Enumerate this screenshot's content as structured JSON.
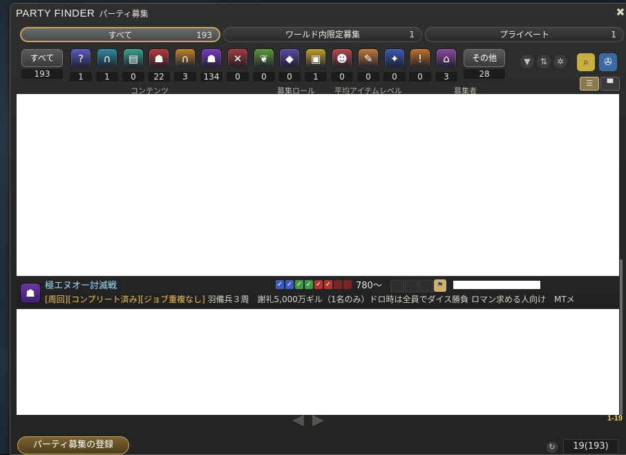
{
  "window": {
    "title": "PARTY FINDER",
    "subtitle": "パーティ募集",
    "close_glyph": "✖"
  },
  "tabs": [
    {
      "label": "すべて",
      "count": "193"
    },
    {
      "label": "ワールド内限定募集",
      "count": "1"
    },
    {
      "label": "プライベート",
      "count": "1"
    }
  ],
  "categories": {
    "all": {
      "label": "すべて",
      "count": "193"
    },
    "items": [
      {
        "icon": "question-icon",
        "glyph": "?",
        "color": "#5a5ac0",
        "count": "1"
      },
      {
        "icon": "arch-icon",
        "glyph": "∩",
        "color": "#2f8aa0",
        "count": "1"
      },
      {
        "icon": "scroll-icon",
        "glyph": "▤",
        "color": "#3aa08a",
        "count": "0"
      },
      {
        "icon": "beast-icon",
        "glyph": "☗",
        "color": "#b83a3a",
        "count": "22"
      },
      {
        "icon": "gate-icon",
        "glyph": "∩",
        "color": "#c0802a",
        "count": "3"
      },
      {
        "icon": "trial-icon",
        "glyph": "☗",
        "color": "#7a3ac0",
        "count": "134"
      },
      {
        "icon": "pvp-icon",
        "glyph": "✕",
        "color": "#a03a3a",
        "count": "0"
      },
      {
        "icon": "leaf-icon",
        "glyph": "❦",
        "color": "#5a9a3a",
        "count": "0"
      },
      {
        "icon": "gem-icon",
        "glyph": "◆",
        "color": "#5a4aa0",
        "count": "0"
      },
      {
        "icon": "treasure-icon",
        "glyph": "▣",
        "color": "#c0a02a",
        "count": "1"
      },
      {
        "icon": "skull-icon",
        "glyph": "☻",
        "color": "#b04a4a",
        "count": "0"
      },
      {
        "icon": "quill-icon",
        "glyph": "✎",
        "color": "#c07a3a",
        "count": "0"
      },
      {
        "icon": "star-icon",
        "glyph": "✦",
        "color": "#3a5ab0",
        "count": "0"
      },
      {
        "icon": "alert-icon",
        "glyph": "!",
        "color": "#c0702a",
        "count": "0"
      },
      {
        "icon": "people-icon",
        "glyph": "⌂",
        "color": "#8a4aa0",
        "count": "3"
      }
    ],
    "other": {
      "label": "その他",
      "count": "28"
    }
  },
  "tools": {
    "filter_glyph": "▼",
    "sort_glyph": "⇅",
    "settings_glyph": "✲",
    "search_glyph": "⌕",
    "detail_glyph": "✇"
  },
  "column_headers": {
    "content": "コンテンツ",
    "role": "募集ロール",
    "ilvl": "平均アイテムレベル",
    "recruiter": "募集者"
  },
  "view_toggle": {
    "compact": "☰",
    "detail": "▀"
  },
  "listing": {
    "duty_icon_glyph": "☗",
    "duty_name": "極エヌオー討滅戦",
    "tags": "[周回][コンプリート済み][ジョブ重複なし]",
    "description": " 羽備兵３周　謝礼5,000万ギル（1名のみ）ドロ時は全員でダイス勝負 ロマン求める人向け　MTメ",
    "slots": [
      {
        "role": "tank",
        "glyph": "✓"
      },
      {
        "role": "tank",
        "glyph": "✓"
      },
      {
        "role": "heal",
        "glyph": "✓"
      },
      {
        "role": "heal",
        "glyph": "✓"
      },
      {
        "role": "dps",
        "glyph": "✓"
      },
      {
        "role": "dps",
        "glyph": "✓"
      },
      {
        "role": "dps-empty",
        "glyph": ""
      },
      {
        "role": "dps-empty",
        "glyph": ""
      }
    ],
    "ilvl": "780〜",
    "recruiter_icon_glyph": "⚑"
  },
  "pager": {
    "prev_glyph": "◀",
    "next_glyph": "▶",
    "range": "1-19"
  },
  "footer": {
    "register_label": "パーティ募集の登録",
    "refresh_glyph": "↻",
    "result_count": "19(193)"
  }
}
